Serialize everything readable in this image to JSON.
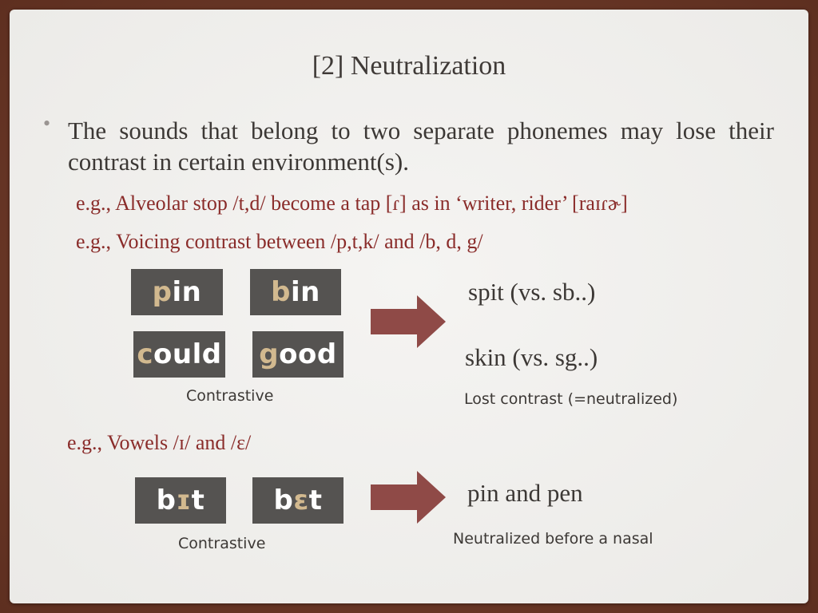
{
  "slide": {
    "title": "[2] Neutralization",
    "bullet": "The sounds that belong to two separate phonemes may lose their contrast in certain environment(s).",
    "examples": [
      "e.g., Alveolar stop /t,d/ become a tap [ɾ] as in ‘writer, rider’ [raɪɾɚ]",
      "e.g., Voicing contrast between /p,t,k/ and /b, d, g/",
      "e.g., Vowels /ɪ/ and /ɛ/"
    ],
    "tiles": [
      {
        "hl": "p",
        "rest": "in"
      },
      {
        "hl": "b",
        "rest": "in"
      },
      {
        "hl": "c",
        "rest": "ould"
      },
      {
        "hl": "g",
        "rest": "ood"
      },
      {
        "pre": "b",
        "hl": "ɪ",
        "rest": "t"
      },
      {
        "pre": "b",
        "hl": "ɛ",
        "rest": "t"
      }
    ],
    "captions": {
      "contrastive_1": "Contrastive",
      "contrastive_2": "Contrastive",
      "lost_contrast": "Lost contrast (=neutralized)",
      "neutralized_nasal": "Neutralized before a nasal"
    },
    "results": {
      "spit": "spit (vs. sb..)",
      "skin": "skin (vs. sg..)",
      "pin_pen": "pin and pen"
    },
    "colors": {
      "accent": "#8a2c2a",
      "arrow": "#8f4a47",
      "tile": "#555351",
      "tile_highlight": "#d2b98f",
      "frame": "#6e3a2a"
    }
  }
}
